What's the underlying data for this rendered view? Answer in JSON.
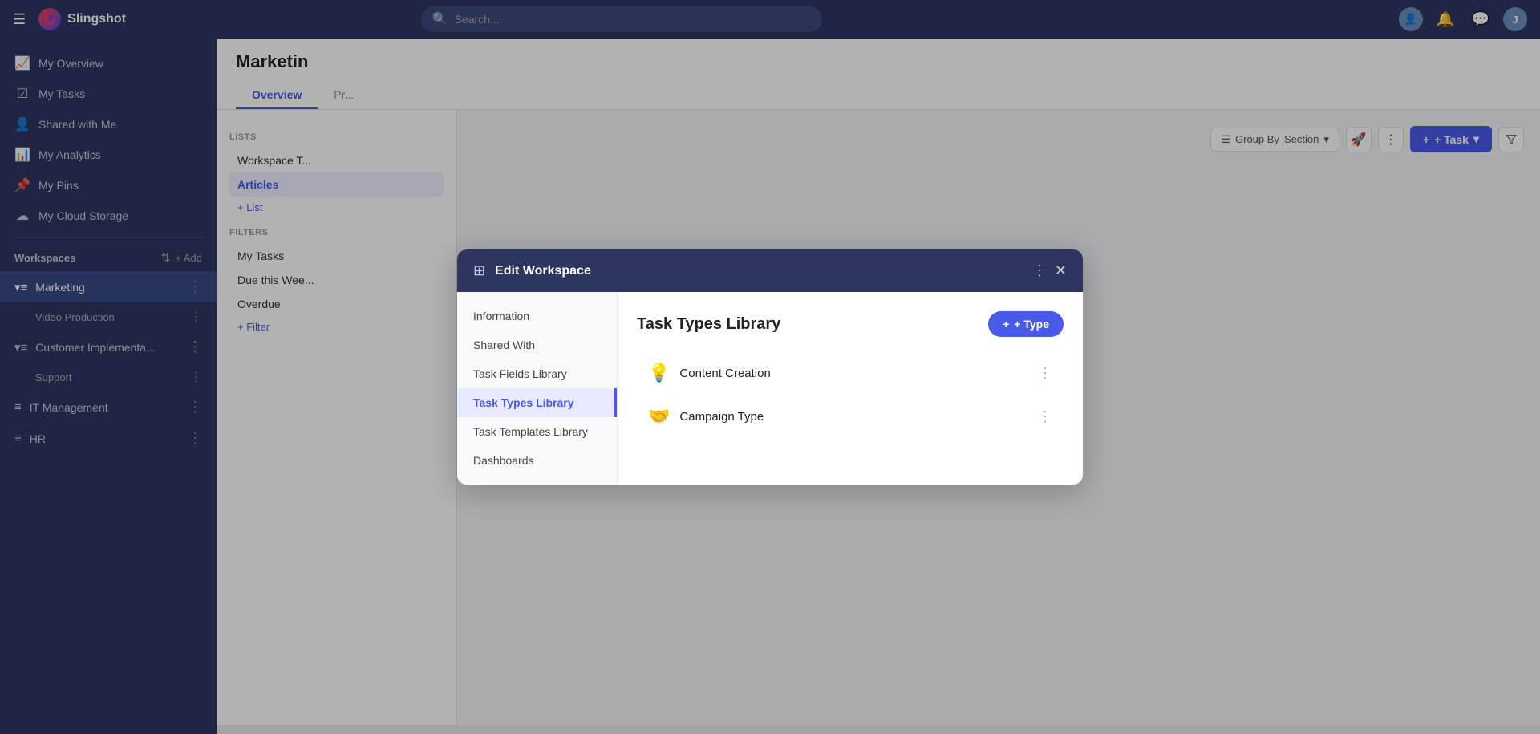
{
  "app": {
    "name": "Slingshot",
    "logo_text": "🚀"
  },
  "topnav": {
    "search_placeholder": "Search...",
    "user_initial": "J"
  },
  "sidebar": {
    "nav_items": [
      {
        "id": "my-overview",
        "label": "My Overview",
        "icon": "📈"
      },
      {
        "id": "my-tasks",
        "label": "My Tasks",
        "icon": "☑"
      },
      {
        "id": "shared-with-me",
        "label": "Shared with Me",
        "icon": "👤"
      },
      {
        "id": "my-analytics",
        "label": "My Analytics",
        "icon": "📊"
      },
      {
        "id": "my-pins",
        "label": "My Pins",
        "icon": "📌"
      },
      {
        "id": "my-cloud-storage",
        "label": "My Cloud Storage",
        "icon": "☁"
      }
    ],
    "workspaces_label": "Workspaces",
    "add_label": "+ Add",
    "workspaces": [
      {
        "id": "marketing",
        "label": "Marketing",
        "icon": "≡",
        "active": true,
        "has_arrow": true
      },
      {
        "id": "video-production",
        "label": "Video Production",
        "icon": "",
        "sub": true
      },
      {
        "id": "customer-implementa",
        "label": "Customer Implementa...",
        "icon": "≡",
        "has_arrow": true
      },
      {
        "id": "support",
        "label": "Support",
        "icon": "",
        "sub": true
      },
      {
        "id": "it-management",
        "label": "IT Management",
        "icon": "≡"
      },
      {
        "id": "hr",
        "label": "HR",
        "icon": "≡"
      }
    ]
  },
  "main": {
    "title": "Marketin",
    "tabs": [
      "Overview",
      "Pr..."
    ],
    "left_panel": {
      "lists_label": "LISTS",
      "list_items": [
        "Workspace T...",
        "Articles"
      ],
      "add_list_label": "+ List",
      "filters_label": "FILTERS",
      "filter_items": [
        "My Tasks",
        "Due this Wee...",
        "Overdue"
      ],
      "add_filter_label": "+ Filter"
    },
    "toolbar": {
      "group_by_label": "Group By",
      "group_by_value": "Section",
      "add_task_label": "+ Task"
    }
  },
  "modal": {
    "title": "Edit Workspace",
    "nav_items": [
      {
        "id": "information",
        "label": "Information"
      },
      {
        "id": "shared-with",
        "label": "Shared With"
      },
      {
        "id": "task-fields-library",
        "label": "Task Fields Library"
      },
      {
        "id": "task-types-library",
        "label": "Task Types Library",
        "active": true
      },
      {
        "id": "task-templates-library",
        "label": "Task Templates Library"
      },
      {
        "id": "dashboards",
        "label": "Dashboards"
      }
    ],
    "content": {
      "title": "Task Types Library",
      "add_type_label": "+ Type",
      "types": [
        {
          "id": "content-creation",
          "label": "Content Creation",
          "icon": "💡"
        },
        {
          "id": "campaign-type",
          "label": "Campaign Type",
          "icon": "🤝"
        }
      ]
    }
  }
}
